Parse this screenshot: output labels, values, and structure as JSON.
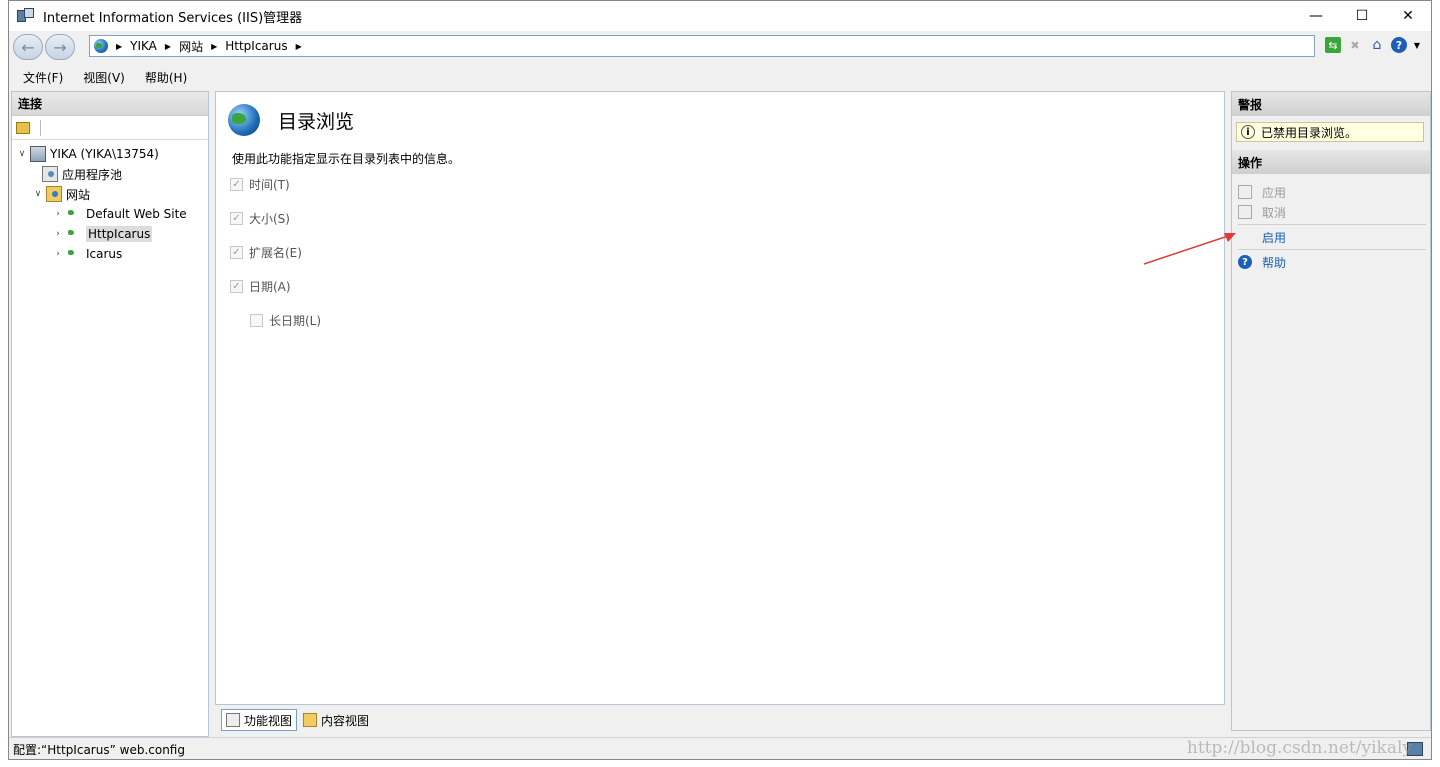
{
  "window": {
    "title": "Internet Information Services (IIS)管理器"
  },
  "addressbar": {
    "crumbs": [
      "YIKA",
      "网站",
      "HttpIcarus"
    ]
  },
  "menu": {
    "items": [
      "文件(F)",
      "视图(V)",
      "帮助(H)"
    ]
  },
  "connections": {
    "header": "连接",
    "tree": {
      "server": "YIKA (YIKA\\13754)",
      "app_pools": "应用程序池",
      "sites": "网站",
      "site_items": [
        "Default Web Site",
        "HttpIcarus",
        "Icarus"
      ]
    }
  },
  "feature": {
    "title": "目录浏览",
    "description": "使用此功能指定显示在目录列表中的信息。",
    "options": [
      {
        "label": "时间(T)",
        "checked": true
      },
      {
        "label": "大小(S)",
        "checked": true
      },
      {
        "label": "扩展名(E)",
        "checked": true
      },
      {
        "label": "日期(A)",
        "checked": true
      },
      {
        "label": "长日期(L)",
        "checked": false
      }
    ]
  },
  "view_tabs": {
    "features": "功能视图",
    "content": "内容视图"
  },
  "alerts": {
    "header": "警报",
    "message": "已禁用目录浏览。"
  },
  "actions": {
    "header": "操作",
    "apply": "应用",
    "cancel": "取消",
    "enable": "启用",
    "help": "帮助"
  },
  "status": {
    "text": "配置:“HttpIcarus” web.config"
  },
  "watermark": "http://blog.csdn.net/yikaly",
  "colors": {
    "link": "#1c5fb8",
    "arrow": "#e03c3c",
    "alert_bg": "#ffffe1"
  }
}
